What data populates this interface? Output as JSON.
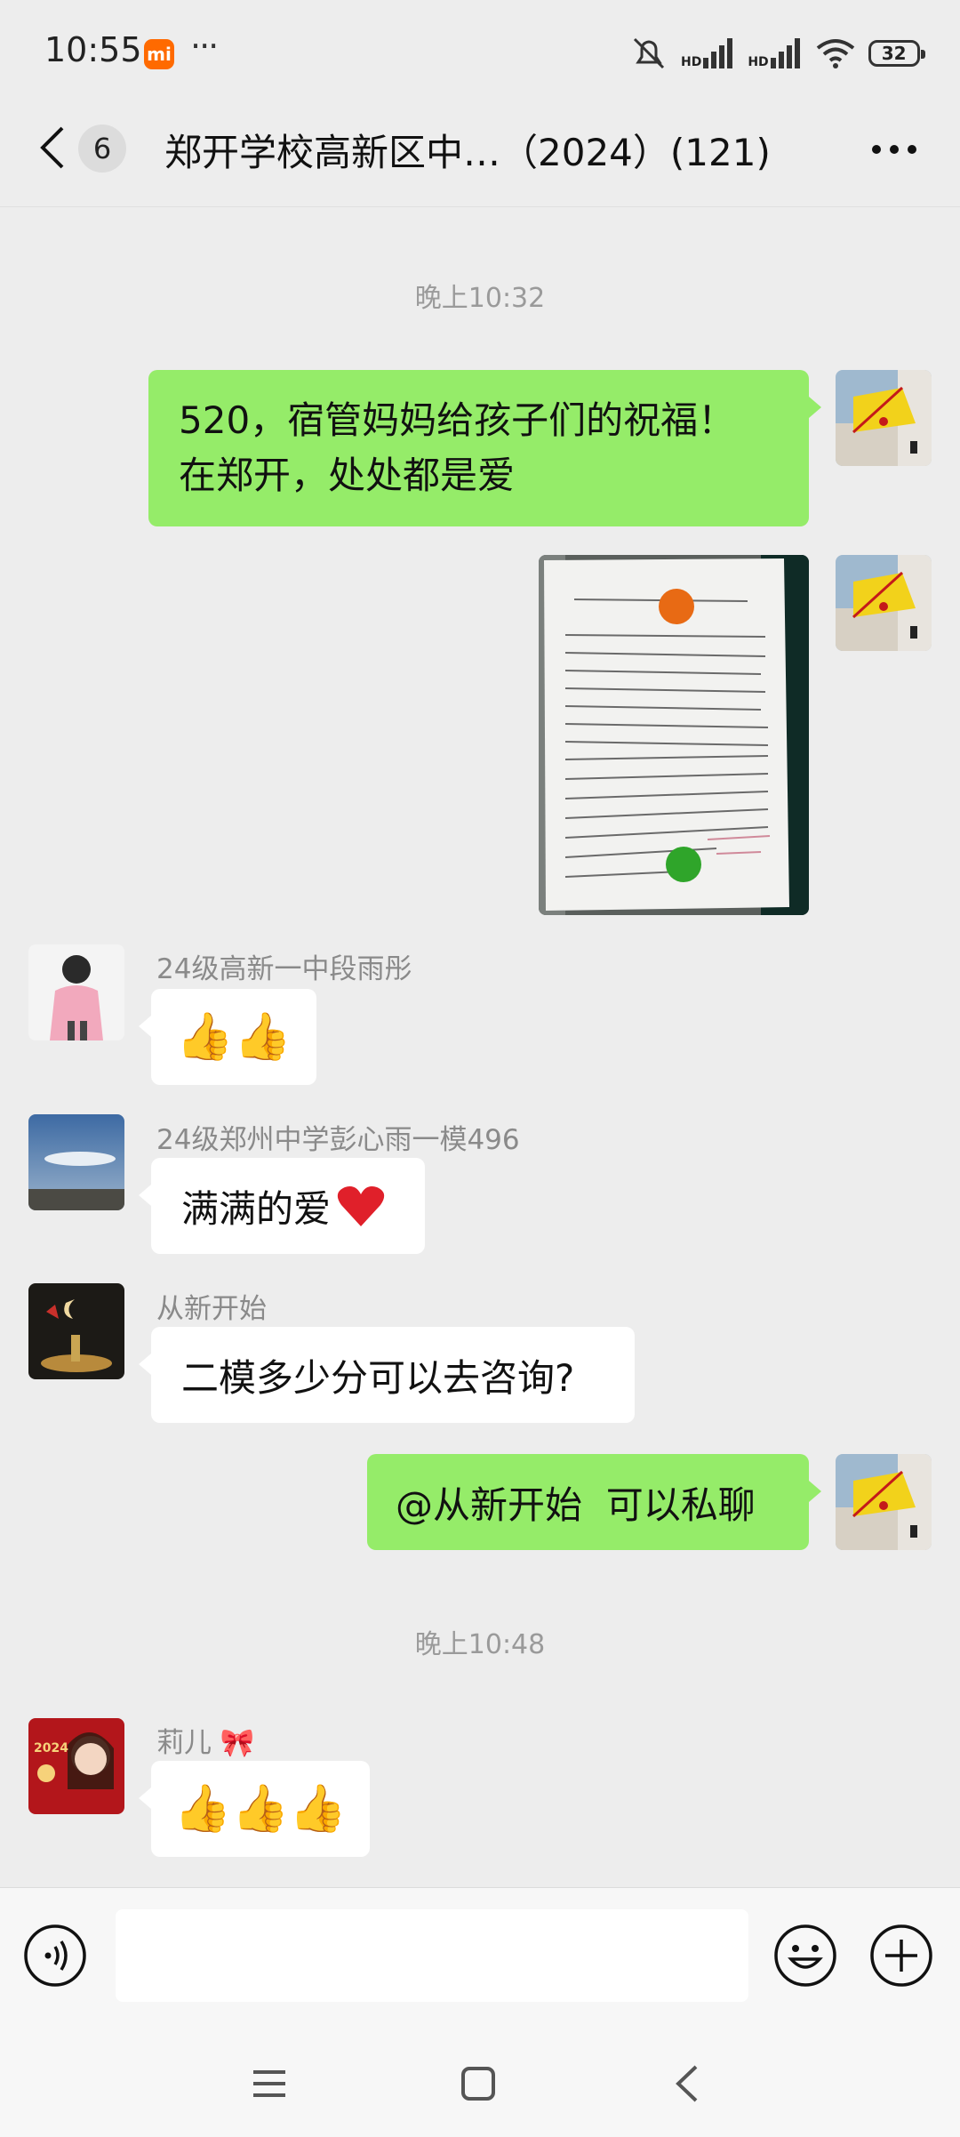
{
  "status_bar": {
    "time": "10:55",
    "brand_badge": "mi",
    "more_dots": "···",
    "hd_labels": [
      "HD",
      "HD"
    ],
    "battery": "32"
  },
  "header": {
    "unread_count": "6",
    "title": "郑开学校高新区中…（2024）(121)"
  },
  "timestamps": [
    "晚上10:32",
    "晚上10:48"
  ],
  "messages": {
    "m1": {
      "text_line1": "520，宿管妈妈给孩子们的祝福！",
      "text_line2": "在郑开，处处都是爱"
    },
    "m3": {
      "sender": "24级高新一中段雨彤",
      "text": "👍👍"
    },
    "m4": {
      "sender": "24级郑州中学彭心雨一模496",
      "text": "满满的爱"
    },
    "m5": {
      "sender": "从新开始",
      "text": "二模多少分可以去咨询?"
    },
    "m6": {
      "text": "@从新开始  可以私聊"
    },
    "m7": {
      "sender": "莉儿",
      "sender_emoji": "🎀",
      "text": "👍👍👍"
    }
  },
  "input": {
    "placeholder": ""
  },
  "avatar_text": {
    "year": "2024"
  },
  "colors": {
    "bubble_self": "#95ec69",
    "bubble_other": "#ffffff",
    "background": "#ededed",
    "heart": "#e0202a"
  },
  "icons": [
    "chevron-left-icon",
    "more-horizontal-icon",
    "voice-icon",
    "emoji-icon",
    "plus-icon",
    "menu-icon",
    "home-square-icon",
    "back-triangle-icon",
    "wifi-icon",
    "signal-icon",
    "mute-icon",
    "battery-icon"
  ]
}
